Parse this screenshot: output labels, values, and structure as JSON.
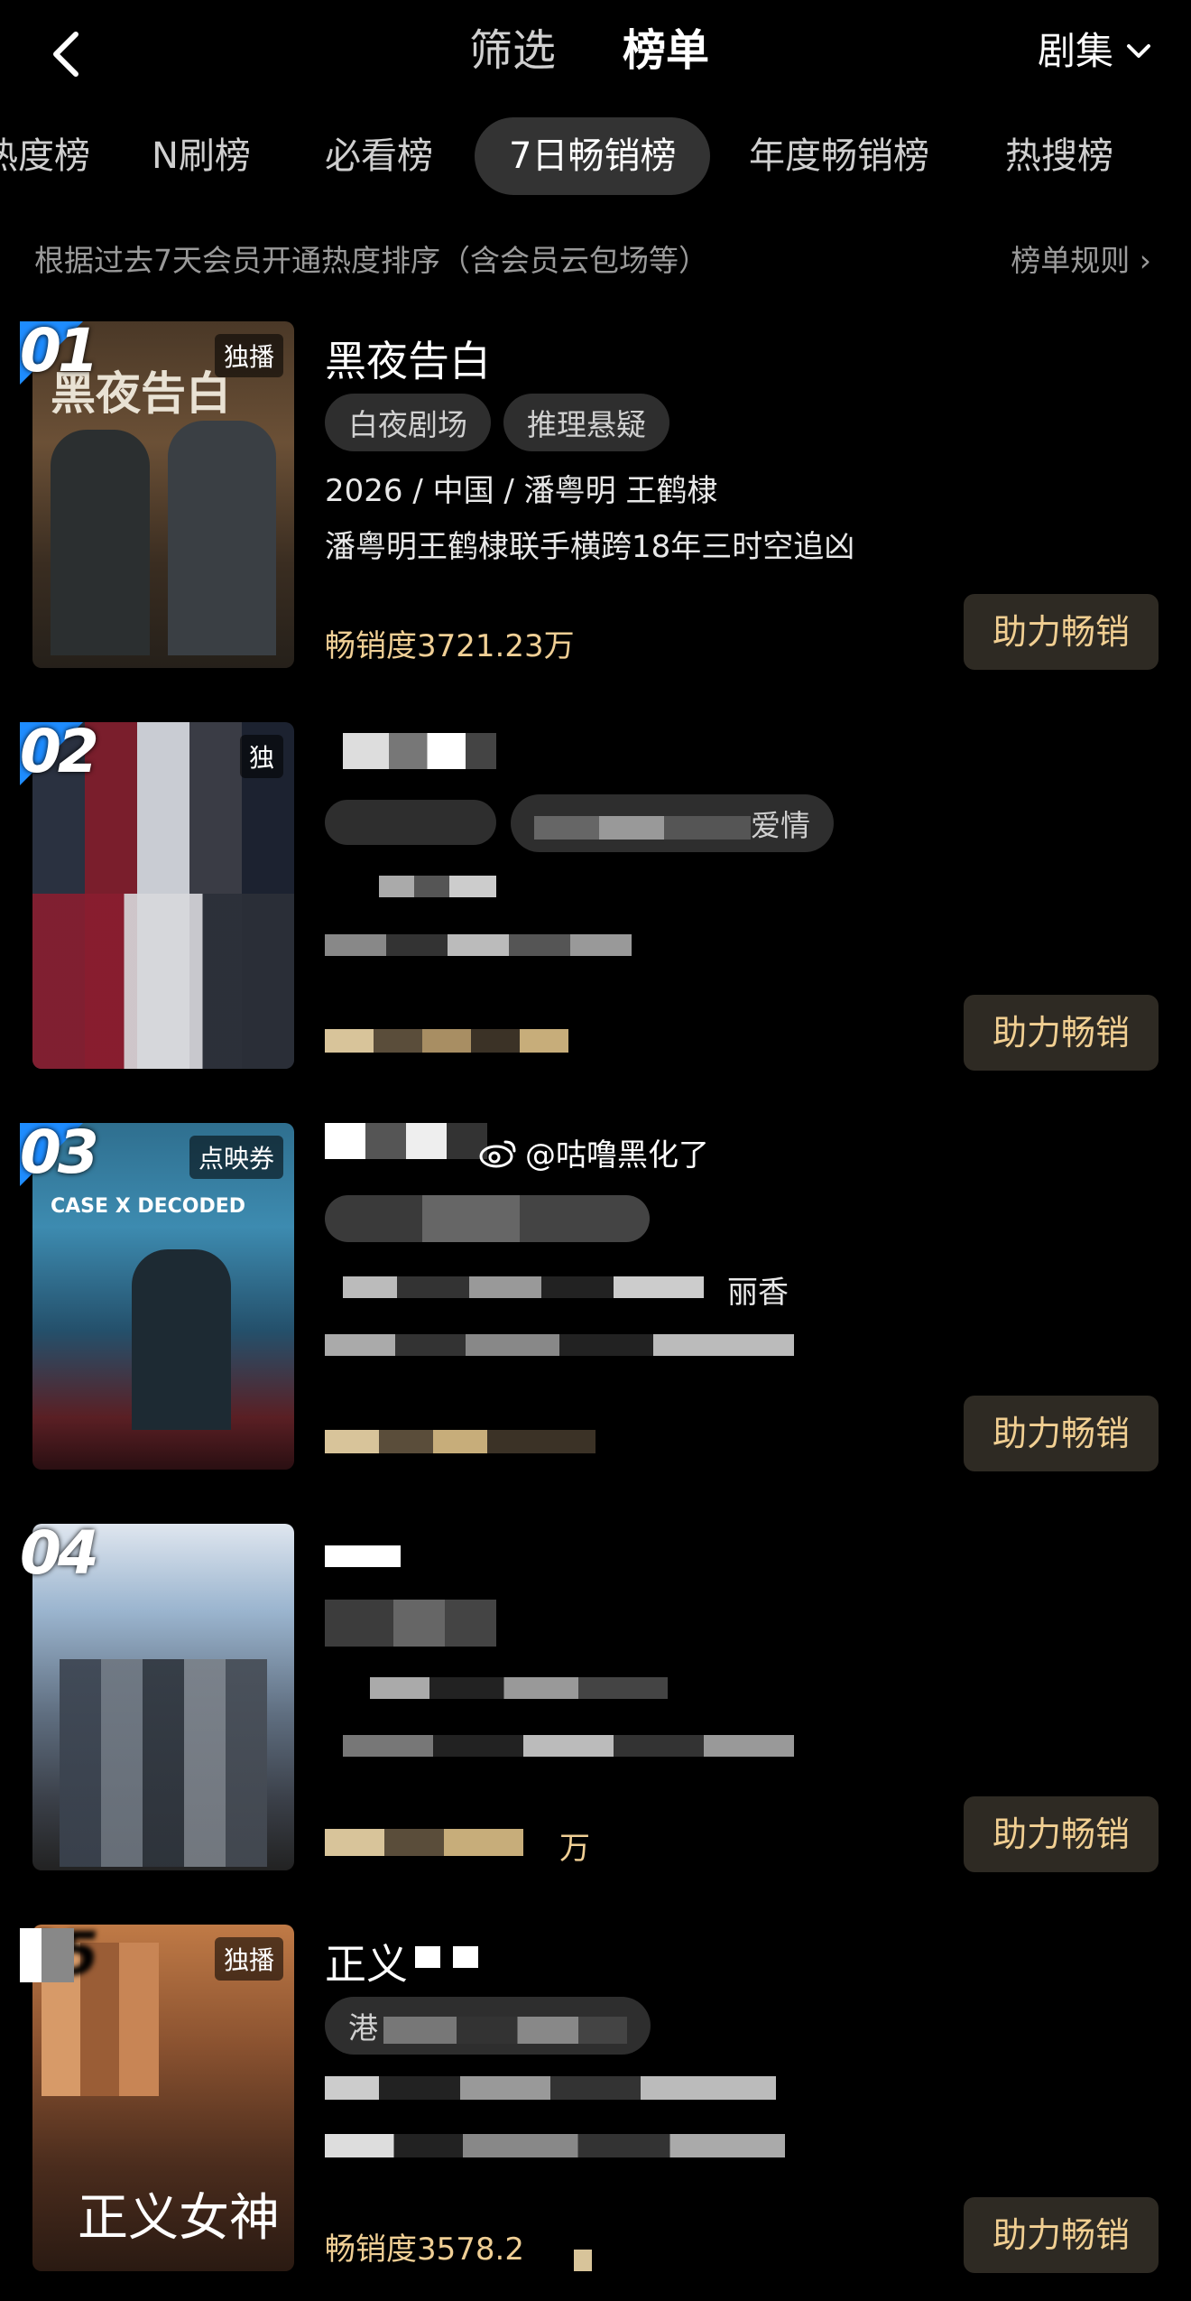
{
  "header": {
    "filter_label": "筛选",
    "list_label": "榜单",
    "category_label": "剧集"
  },
  "tabs": [
    {
      "label": "热度榜"
    },
    {
      "label": "N刷榜"
    },
    {
      "label": "必看榜"
    },
    {
      "label": "7日畅销榜"
    },
    {
      "label": "年度畅销榜"
    },
    {
      "label": "热搜榜"
    }
  ],
  "description": "根据过去7天会员开通热度排序（含会员云包场等）",
  "rules_label": "榜单规则",
  "items": [
    {
      "rank": "01",
      "badge": "独播",
      "poster_title": "黑夜告白",
      "title": "黑夜告白",
      "tags": [
        "白夜剧场",
        "推理悬疑"
      ],
      "meta": "2026 / 中国 / 潘粤明 王鹤棣",
      "summary": "潘粤明王鹤棣联手横跨18年三时空追凶",
      "sales": "畅销度3721.23万",
      "button": "助力畅销"
    },
    {
      "rank": "02",
      "badge": "独",
      "tag_visible": "爱情",
      "button": "助力畅销"
    },
    {
      "rank": "03",
      "badge": "点映券",
      "poster_title": "CASE X DECODED",
      "meta_visible": "丽香",
      "button": "助力畅销"
    },
    {
      "rank": "04",
      "sales_visible": "万",
      "button": "助力畅销"
    },
    {
      "rank": "05",
      "badge": "独播",
      "poster_title": "正义女神",
      "title_visible": "正义",
      "tag_visible": "港",
      "sales": "畅销度3578.2",
      "button": "助力畅销"
    }
  ],
  "watermark": "@咕噜黑化了"
}
